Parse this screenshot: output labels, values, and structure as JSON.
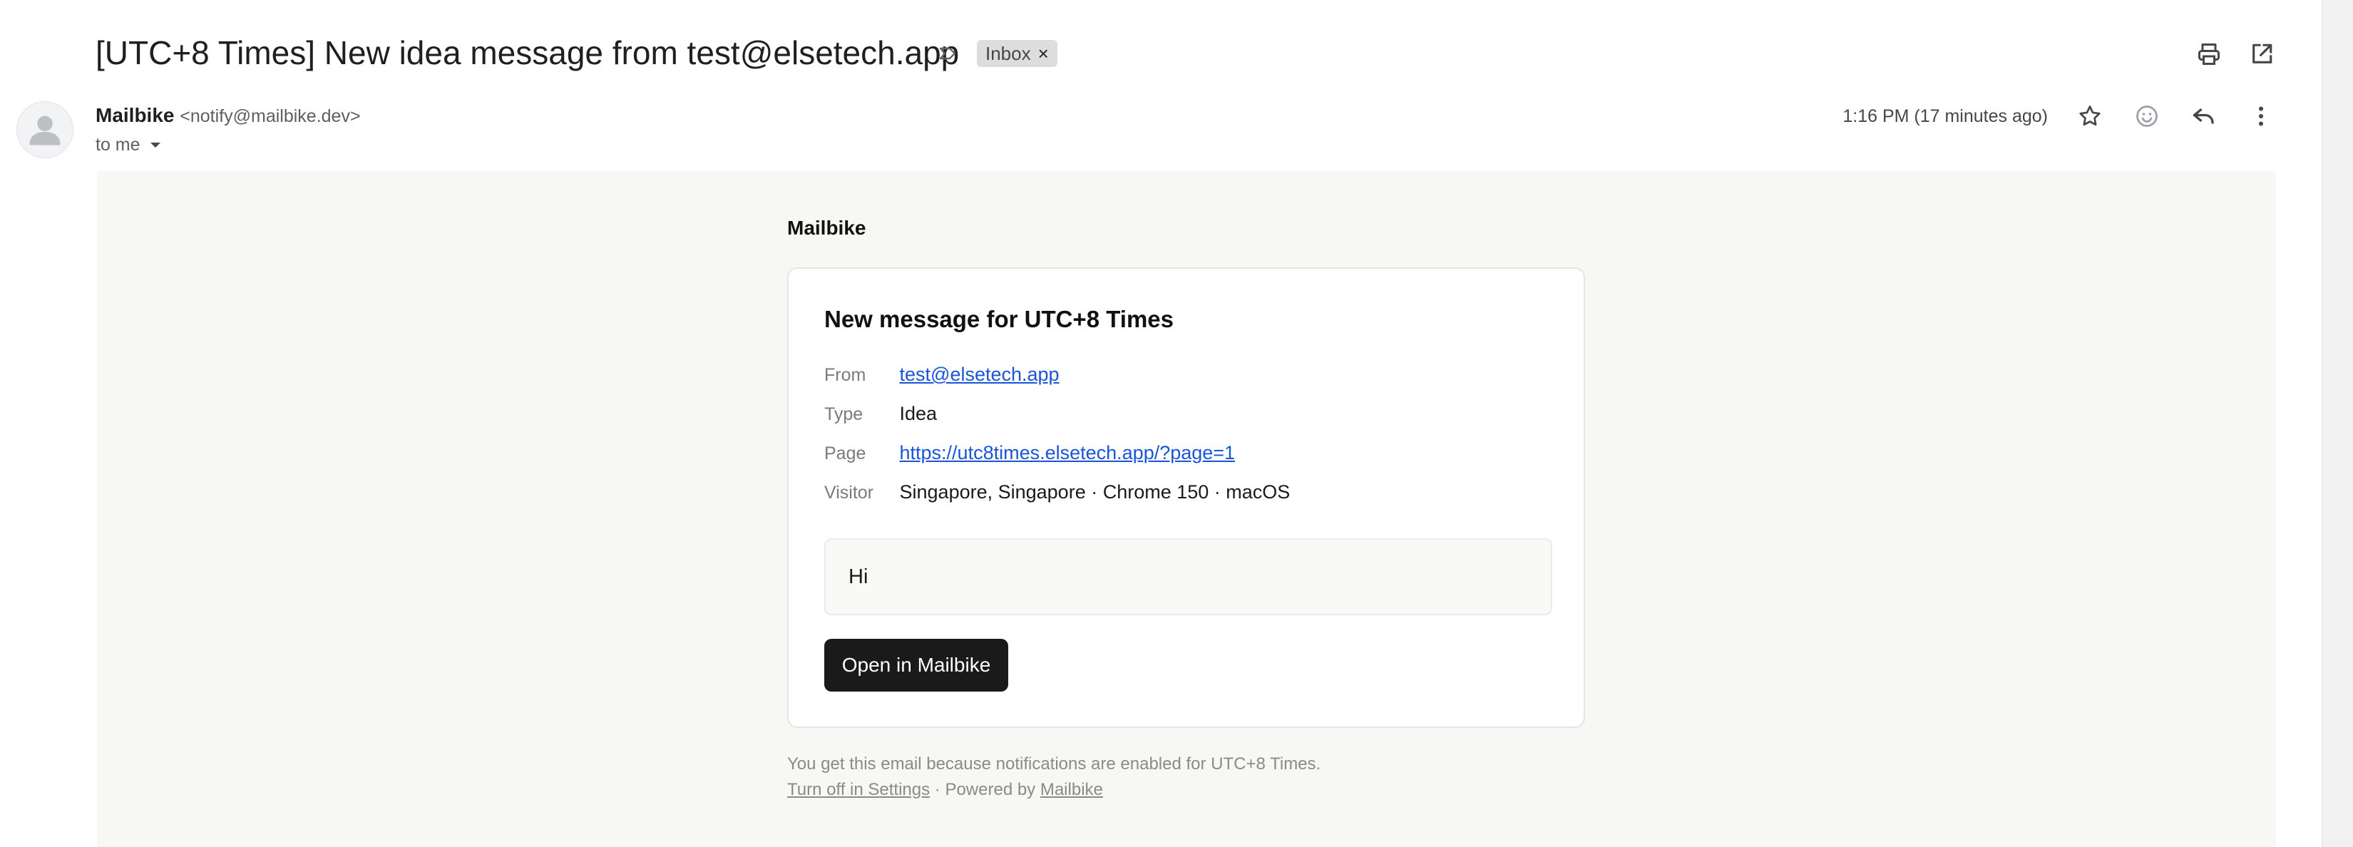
{
  "header": {
    "subject": "[UTC+8 Times] New idea message from test@elsetech.app",
    "label_badge": "Inbox",
    "label_remove_glyph": "×",
    "icons": [
      "important-marker-icon",
      "print-icon",
      "open-in-new-window-icon"
    ]
  },
  "sender": {
    "name": "Mailbike",
    "email": "<notify@mailbike.dev>",
    "recipient_label": "to me",
    "timestamp": "1:16 PM (17 minutes ago)",
    "icons": [
      "avatar-icon",
      "chevron-down-icon",
      "star-icon",
      "emoji-icon",
      "reply-icon",
      "more-vert-icon"
    ]
  },
  "email": {
    "brand": "Mailbike",
    "card_title": "New message for UTC+8 Times",
    "fields": [
      {
        "label": "From",
        "value": "test@elsetech.app",
        "is_link": true
      },
      {
        "label": "Type",
        "value": "Idea",
        "is_link": false
      },
      {
        "label": "Page",
        "value": "https://utc8times.elsetech.app/?page=1",
        "is_link": true
      },
      {
        "label": "Visitor",
        "value": "Singapore, Singapore · Chrome 150 · macOS",
        "is_link": false
      }
    ],
    "message": "Hi",
    "cta_label": "Open in Mailbike",
    "footer": {
      "line1": "You get this email because notifications are enabled for UTC+8 Times.",
      "settings_link": "Turn off in Settings",
      "separator": " · Powered by ",
      "powered_link": "Mailbike"
    }
  },
  "colors": {
    "link": "#1a55d9",
    "button_bg": "#1a1a1a",
    "body_bg": "#f7f7f5",
    "badge_bg": "#dddddd"
  }
}
